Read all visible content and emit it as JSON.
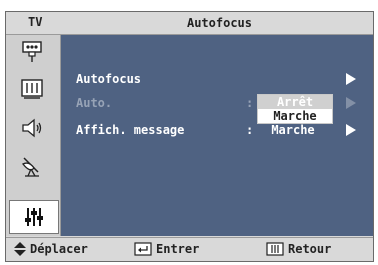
{
  "header": {
    "tv_label": "TV",
    "title": "Autofocus"
  },
  "sidebar": {
    "items": [
      {
        "icon": "input-icon"
      },
      {
        "icon": "picture-icon"
      },
      {
        "icon": "sound-icon"
      },
      {
        "icon": "channel-icon"
      },
      {
        "icon": "setup-icon",
        "selected": true
      }
    ]
  },
  "menu": {
    "items": [
      {
        "label": "Autofocus",
        "value": "",
        "enabled": true
      },
      {
        "label": "Auto.",
        "value": "",
        "enabled": false
      },
      {
        "label": "Affich. message",
        "value": "Marche",
        "enabled": true
      }
    ],
    "popup": {
      "options": [
        "Arrêt",
        "Marche"
      ],
      "selected": "Marche"
    }
  },
  "footer": {
    "move": "Déplacer",
    "enter": "Entrer",
    "return": "Retour"
  },
  "colors": {
    "menu_bg": "#4f6282",
    "chrome": "#d9d9d9",
    "disabled": "#97a3b6"
  }
}
